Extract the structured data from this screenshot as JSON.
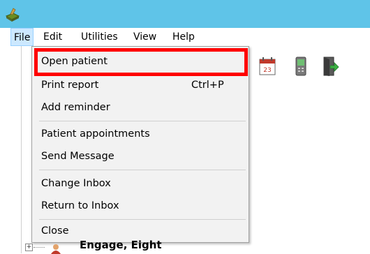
{
  "menubar": {
    "items": [
      {
        "label": "File",
        "active": true
      },
      {
        "label": "Edit"
      },
      {
        "label": "Utilities"
      },
      {
        "label": "View"
      },
      {
        "label": "Help"
      }
    ]
  },
  "file_menu": {
    "items": [
      {
        "label": "Open patient",
        "shortcut": ""
      },
      {
        "label": "Print report",
        "shortcut": "Ctrl+P"
      },
      {
        "label": "Add reminder",
        "shortcut": ""
      },
      {
        "label": "Patient appointments",
        "shortcut": ""
      },
      {
        "label": "Send Message",
        "shortcut": ""
      },
      {
        "label": "Change Inbox",
        "shortcut": ""
      },
      {
        "label": "Return to Inbox",
        "shortcut": ""
      },
      {
        "label": "Close",
        "shortcut": ""
      }
    ]
  },
  "toolbar": {
    "calendar_day": "23",
    "icons": [
      "calendar-icon",
      "phone-icon",
      "exit-door-icon"
    ]
  },
  "tree": {
    "expander": "+",
    "item_label": "Engage, Eight"
  },
  "colors": {
    "titlebar": "#5fc4e8",
    "highlight": "#ff0000",
    "menu_active": "#cce8ff"
  }
}
